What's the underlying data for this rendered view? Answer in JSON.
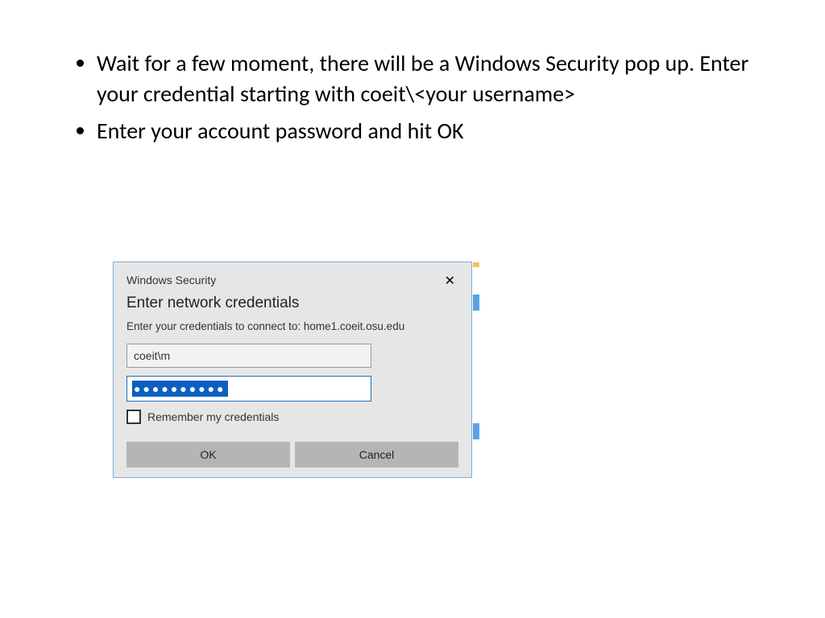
{
  "instructions": [
    "Wait for a few moment, there will be a Windows Security pop up. Enter your credential starting with coeit\\<your username>",
    "Enter your account password and hit OK"
  ],
  "dialog": {
    "app_title": "Windows Security",
    "subtitle": "Enter network credentials",
    "instruction": "Enter your credentials to connect to: home1.coeit.osu.edu",
    "username_value": "coeit\\m",
    "password_masked": "●●●●●●●●●●",
    "remember_label": "Remember my credentials",
    "remember_checked": false,
    "ok_label": "OK",
    "cancel_label": "Cancel",
    "close_glyph": "✕"
  }
}
